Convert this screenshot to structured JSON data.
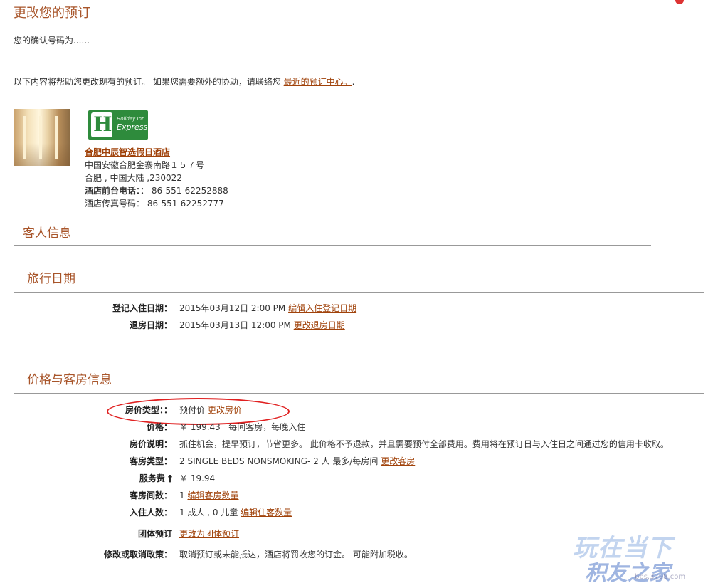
{
  "page": {
    "title": "更改您的预订",
    "confirmation_text": "您的确认号码为......",
    "help_text": "以下内容将帮助您更改现有的预订。 如果您需要额外的协助，请联络您 ",
    "help_link": "最近的预订中心。",
    "help_suffix": "."
  },
  "hotel": {
    "logo_text_small": "Holiday Inn",
    "logo_text_large": "Express",
    "name": "合肥中辰智选假日酒店",
    "address_line1": "中国安徽合肥金寨南路１５７号",
    "address_line2": "合肥 , 中国大陆 ,230022",
    "phone_label": "酒店前台电话：：",
    "phone": "86-551-62252888",
    "fax_label": "酒店传真号码：",
    "fax": "86-551-62252777"
  },
  "guest_section": {
    "title": "客人信息"
  },
  "travel_section": {
    "title": "旅行日期",
    "checkin_label": "登记入住日期：",
    "checkin_value": "2015年03月12日 2:00 PM",
    "checkin_link": "编辑入住登记日期",
    "checkout_label": "退房日期：",
    "checkout_value": "2015年03月13日 12:00 PM",
    "checkout_link": "更改退房日期"
  },
  "price_section": {
    "title": "价格与客房信息",
    "rate_type_label": "房价类型：：",
    "rate_type_value": "预付价",
    "rate_type_link": "更改房价",
    "price_label": "价格：",
    "price_value": "￥ 199.43   每间客房，每晚入住",
    "rate_desc_label": "房价说明：",
    "rate_desc_value": "抓住机会，提早预订，节省更多。 此价格不予退款，并且需要预付全部费用。费用将在预订日与入住日之间通过您的信用卡收取。",
    "room_type_label": "客房类型：",
    "room_type_value": "2 SINGLE BEDS NONSMOKING- 2 人 最多/每房间",
    "room_type_link": "更改客房",
    "service_fee_label": "服务费 †",
    "service_fee_value": "￥ 19.94",
    "rooms_label": "客房间数：",
    "rooms_value": "1",
    "rooms_link": "编辑客房数量",
    "guests_label": "入住人数：",
    "guests_value": "1 成人 , 0 儿童",
    "guests_link": "编辑住客数量",
    "group_label": "团体预订",
    "group_link": "更改为团体预订",
    "policy_label": "修改或取消政策：",
    "policy_value": "取消预订或未能抵达，酒店将罚收您的订金。 可能附加税收。"
  },
  "watermark": {
    "line1": "玩在当下",
    "line2": "积友之家",
    "url": "bbs.3798.com"
  },
  "colors": {
    "accent": "#a8552a",
    "link": "#a0420a",
    "highlight": "#e02020"
  }
}
